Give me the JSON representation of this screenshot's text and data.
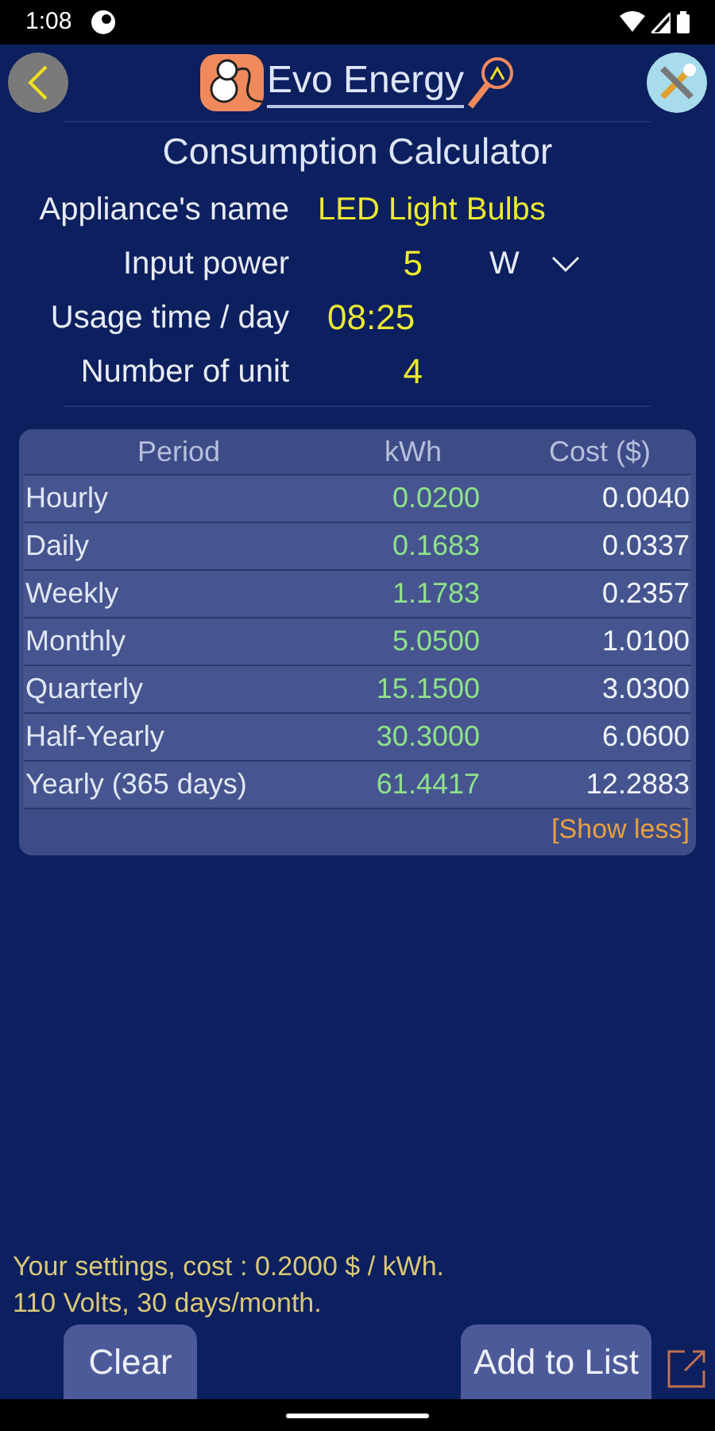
{
  "status_bar": {
    "time": "1:08"
  },
  "header": {
    "app_name": "Evo Energy"
  },
  "title": "Consumption Calculator",
  "form": {
    "appliance_label": "Appliance's name",
    "appliance_value": "LED Light Bulbs",
    "power_label": "Input power",
    "power_value": "5",
    "power_unit": "W",
    "usage_label": "Usage time / day",
    "usage_value": "08:25",
    "units_label": "Number of unit",
    "units_value": "4"
  },
  "table": {
    "columns": [
      "Period",
      "kWh",
      "Cost ($)"
    ],
    "rows": [
      [
        "Hourly",
        "0.0200",
        "0.0040"
      ],
      [
        "Daily",
        "0.1683",
        "0.0337"
      ],
      [
        "Weekly",
        "1.1783",
        "0.2357"
      ],
      [
        "Monthly",
        "5.0500",
        "1.0100"
      ],
      [
        "Quarterly",
        "15.1500",
        "3.0300"
      ],
      [
        "Half-Yearly",
        "30.3000",
        "6.0600"
      ],
      [
        "Yearly (365 days)",
        "61.4417",
        "12.2883"
      ]
    ],
    "toggle": "[Show less]"
  },
  "settings": [
    "Your settings, cost : 0.2000 $ / kWh.",
    "110 Volts, 30 days/month."
  ],
  "buttons": {
    "clear": "Clear",
    "add": "Add to List"
  }
}
